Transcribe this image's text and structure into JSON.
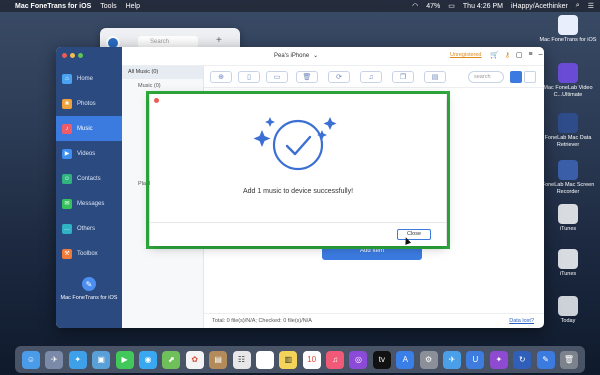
{
  "menubar": {
    "app_name": "Mac FoneTrans for iOS",
    "menus": [
      "Tools",
      "Help"
    ],
    "battery": "47%",
    "clock": "Thu 4:26 PM",
    "user": "iHappy/Acethinker"
  },
  "desktop_icons": [
    {
      "label": "Mac FoneTrans for iOS"
    },
    {
      "label": "Mac FoneLab Video C...Ultimate"
    },
    {
      "label": "FoneLab Mac Data Retriever"
    },
    {
      "label": "FoneLab Mac Screen Recorder"
    },
    {
      "label": "iTunes"
    },
    {
      "label": "iTunes"
    },
    {
      "label": "Today"
    }
  ],
  "bg_window": {
    "search_placeholder": "Search"
  },
  "app": {
    "device_name": "Pea's iPhone",
    "unregistered": "Unregistered",
    "search_placeholder": "search",
    "sidebar": {
      "items": [
        {
          "label": "Home",
          "color": "#4aa3f0"
        },
        {
          "label": "Photos",
          "color": "#f0a23a"
        },
        {
          "label": "Music",
          "color": "#ef5b6a"
        },
        {
          "label": "Videos",
          "color": "#3e8df0"
        },
        {
          "label": "Contacts",
          "color": "#2fb47f"
        },
        {
          "label": "Messages",
          "color": "#35c25c"
        },
        {
          "label": "Others",
          "color": "#2fb2c4"
        },
        {
          "label": "Toolbox",
          "color": "#f07a3a"
        }
      ],
      "active_index": 2,
      "brand": "Mac FoneTrans for iOS"
    },
    "library": {
      "all_music": "All Music (0)",
      "partial_labels": [
        "Music (0)",
        "Playlist"
      ]
    },
    "add_button": "Add Item",
    "status": "Total: 0 file(s)/N/A; Checked: 0 file(s)/N/A",
    "data_lost": "Data lost?"
  },
  "dialog": {
    "message": "Add 1 music to device successfully!",
    "close_label": "Close",
    "accent": "#3b6fd4",
    "highlight": "#2fae3e"
  }
}
